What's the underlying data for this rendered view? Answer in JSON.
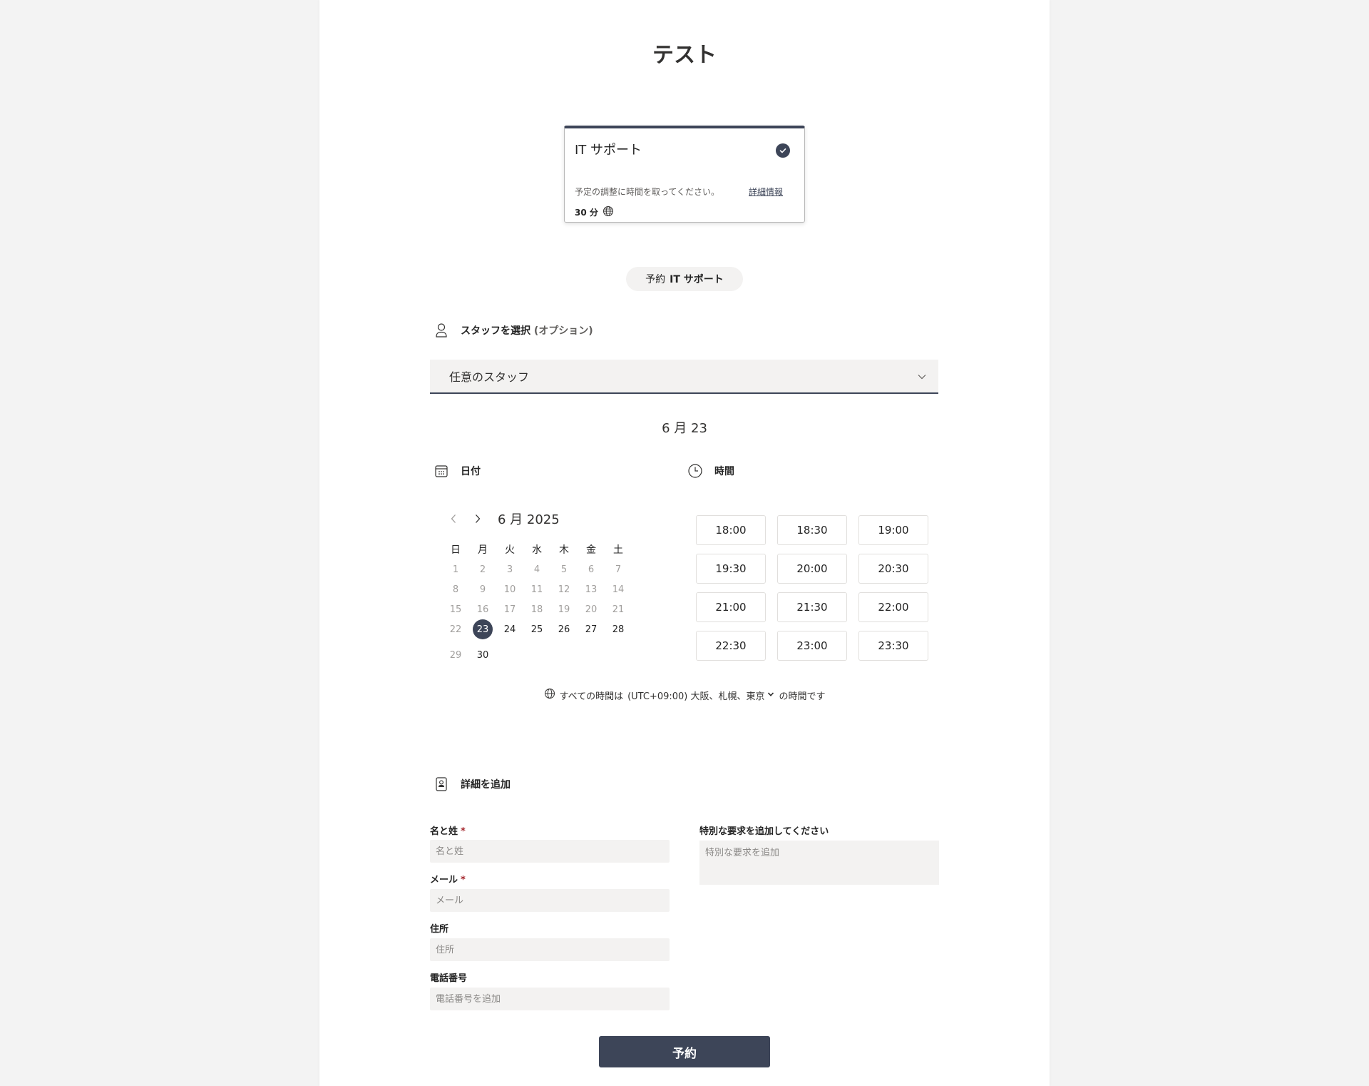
{
  "page": {
    "title": "テスト"
  },
  "service": {
    "name": "IT サポート",
    "description": "予定の調整に時間を取ってください。",
    "details_link": "詳細情報",
    "duration": "30 分"
  },
  "booking_pill": {
    "prefix": "予約",
    "service": "IT サポート"
  },
  "staff": {
    "heading": "スタッフを選択",
    "optional": "(オプション)",
    "selected": "任意のスタッフ"
  },
  "selected_date": "6 月 23",
  "date_section": {
    "heading": "日付"
  },
  "time_section": {
    "heading": "時間"
  },
  "calendar": {
    "month_label": "6 月 2025",
    "weekdays": [
      "日",
      "月",
      "火",
      "水",
      "木",
      "金",
      "土"
    ],
    "rows": [
      [
        "1",
        "2",
        "3",
        "4",
        "5",
        "6",
        "7"
      ],
      [
        "8",
        "9",
        "10",
        "11",
        "12",
        "13",
        "14"
      ],
      [
        "15",
        "16",
        "17",
        "18",
        "19",
        "20",
        "21"
      ],
      [
        "22",
        "23",
        "24",
        "25",
        "26",
        "27",
        "28"
      ],
      [
        "29",
        "30",
        "",
        "",
        "",
        "",
        ""
      ]
    ],
    "selected_day": "23",
    "available_days": [
      "23",
      "24",
      "25",
      "26",
      "27",
      "28",
      "30"
    ]
  },
  "time_slots": [
    "18:00",
    "18:30",
    "19:00",
    "19:30",
    "20:00",
    "20:30",
    "21:00",
    "21:30",
    "22:00",
    "22:30",
    "23:00",
    "23:30"
  ],
  "timezone": {
    "prefix": "すべての時間は",
    "zone": "(UTC+09:00) 大阪、札幌、東京",
    "suffix": "の時間です"
  },
  "details_section": {
    "heading": "詳細を追加"
  },
  "form": {
    "name": {
      "label": "名と姓",
      "required_mark": "*",
      "placeholder": "名と姓"
    },
    "email": {
      "label": "メール",
      "required_mark": "*",
      "placeholder": "メール"
    },
    "address": {
      "label": "住所",
      "placeholder": "住所"
    },
    "phone": {
      "label": "電話番号",
      "placeholder": "電話番号を追加"
    },
    "special": {
      "label": "特別な要求を追加してください",
      "placeholder": "特別な要求を追加"
    }
  },
  "submit_label": "予約",
  "colors": {
    "accent": "#3d4558",
    "background": "#f3f3f3",
    "input_bg": "#f3f2f1"
  }
}
